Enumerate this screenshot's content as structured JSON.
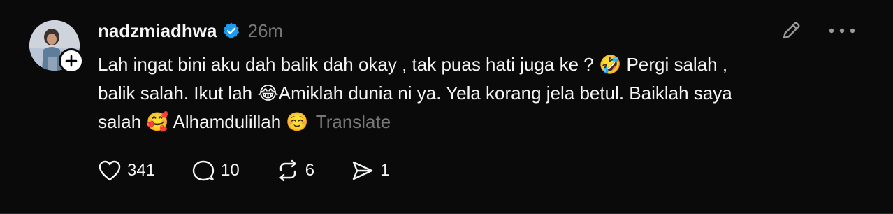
{
  "post": {
    "username": "nadzmiadhwa",
    "timestamp": "26m",
    "text_lines": [
      "Lah ingat bini aku dah balik dah okay , tak puas hati juga ke ? 🤣 Pergi salah ,",
      "balik salah. Ikut lah 😂Amiklah dunia ni ya. Yela korang jela betul. Baiklah saya",
      "salah 🥰 Alhamdulillah ☺️"
    ],
    "translate_label": "Translate",
    "stats": {
      "likes": "341",
      "replies": "10",
      "reposts": "6",
      "shares": "1"
    }
  },
  "colors": {
    "background": "#0a0a0a",
    "text": "#f3f5f7",
    "muted": "#777777",
    "verified": "#1d9bf0"
  },
  "icons": {
    "verified": "verified-badge-icon",
    "edit": "pencil-icon",
    "more": "more-horizontal-icon",
    "follow": "plus-icon",
    "like": "heart-icon",
    "reply": "comment-icon",
    "repost": "repost-icon",
    "share": "send-icon"
  }
}
